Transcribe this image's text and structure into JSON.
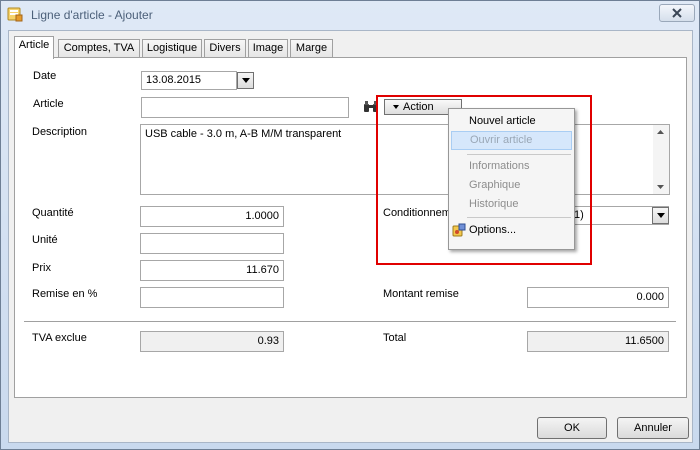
{
  "window": {
    "title": "Ligne d'article - Ajouter",
    "close_icon": "close-x-icon"
  },
  "tabs": [
    {
      "label": "Article",
      "active": true
    },
    {
      "label": "Comptes, TVA"
    },
    {
      "label": "Logistique"
    },
    {
      "label": "Divers"
    },
    {
      "label": "Image"
    },
    {
      "label": "Marge"
    }
  ],
  "form": {
    "date_label": "Date",
    "date_value": "13.08.2015",
    "article_label": "Article",
    "article_value": "",
    "action_label": "Action",
    "description_label": "Description",
    "description_value": "USB cable - 3.0 m, A-B M/M transparent",
    "quantite_label": "Quantité",
    "quantite_value": "1.0000",
    "unite_label": "Unité",
    "unite_value": "",
    "prix_label": "Prix",
    "prix_value": "11.670",
    "remise_label": "Remise en %",
    "remise_value": "",
    "conditionnement_label": "Conditionnem",
    "conditionnement_value": "1)",
    "montant_remise_label": "Montant remise",
    "montant_remise_value": "0.000",
    "tva_exclue_label": "TVA exclue",
    "tva_exclue_value": "0.93",
    "total_label": "Total",
    "total_value": "11.6500"
  },
  "action_menu": {
    "nouvel_article": "Nouvel article",
    "ouvrir_article": "Ouvrir article",
    "informations": "Informations",
    "graphique": "Graphique",
    "historique": "Historique",
    "options": "Options..."
  },
  "buttons": {
    "ok": "OK",
    "annuler": "Annuler"
  },
  "colors": {
    "highlight": "#e00000",
    "menu_hover": "#d6e7fb"
  }
}
